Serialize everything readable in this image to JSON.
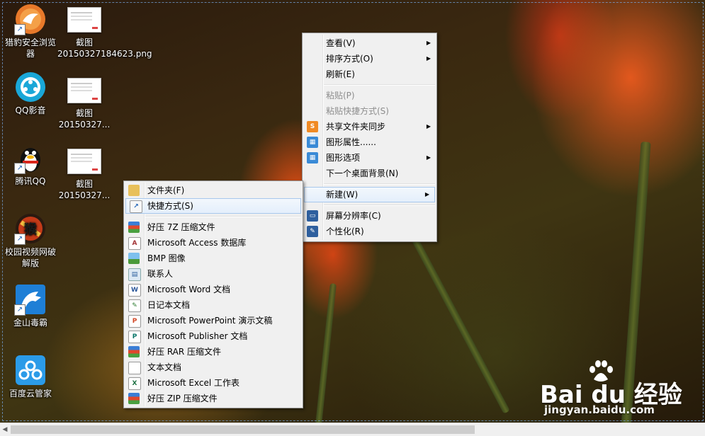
{
  "desktop_icons": [
    {
      "label": "猎豹安全浏览器",
      "icon": "cheetah-browser-icon",
      "shortcut": true
    },
    {
      "label": "QQ影音",
      "icon": "qq-player-icon",
      "shortcut": false
    },
    {
      "label": "腾讯QQ",
      "icon": "qq-penguin-icon",
      "shortcut": true
    },
    {
      "label": "校园视频网破解版",
      "icon": "campus-video-icon",
      "shortcut": true
    },
    {
      "label": "金山毒霸",
      "icon": "kingsoft-antivirus-icon",
      "shortcut": true
    },
    {
      "label": "百度云管家",
      "icon": "baidu-cloud-icon",
      "shortcut": false
    },
    {
      "label": "截图 20150327184623.png",
      "icon": "screenshot-thumbnail",
      "shortcut": false
    },
    {
      "label": "截图 20150327...",
      "icon": "screenshot-thumbnail",
      "shortcut": false
    },
    {
      "label": "截图 20150327...",
      "icon": "screenshot-thumbnail",
      "shortcut": false
    }
  ],
  "context_menu": {
    "items": [
      {
        "label": "查看(V)",
        "submenu": true
      },
      {
        "label": "排序方式(O)",
        "submenu": true
      },
      {
        "label": "刷新(E)"
      },
      {
        "label": "粘贴(P)",
        "disabled": true
      },
      {
        "label": "粘贴快捷方式(S)",
        "disabled": true
      },
      {
        "label": "共享文件夹同步",
        "submenu": true,
        "icon": "share-sync-icon"
      },
      {
        "label": "图形属性......",
        "icon": "graphics-properties-icon"
      },
      {
        "label": "图形选项",
        "submenu": true,
        "icon": "graphics-options-icon"
      },
      {
        "label": "下一个桌面背景(N)"
      },
      {
        "label": "新建(W)",
        "submenu": true,
        "highlighted": true
      },
      {
        "label": "屏幕分辨率(C)",
        "icon": "screen-resolution-icon"
      },
      {
        "label": "个性化(R)",
        "icon": "personalize-icon"
      }
    ]
  },
  "new_submenu": {
    "items": [
      {
        "label": "文件夹(F)",
        "icon": "folder-icon"
      },
      {
        "label": "快捷方式(S)",
        "icon": "shortcut-icon",
        "highlighted": true
      },
      {
        "label": "好压 7Z 压缩文件",
        "icon": "haozip-7z-icon"
      },
      {
        "label": "Microsoft Access 数据库",
        "icon": "access-icon"
      },
      {
        "label": "BMP 图像",
        "icon": "bmp-image-icon"
      },
      {
        "label": "联系人",
        "icon": "contact-icon"
      },
      {
        "label": "Microsoft Word 文档",
        "icon": "word-icon"
      },
      {
        "label": "日记本文档",
        "icon": "journal-icon"
      },
      {
        "label": "Microsoft PowerPoint 演示文稿",
        "icon": "powerpoint-icon"
      },
      {
        "label": "Microsoft Publisher 文档",
        "icon": "publisher-icon"
      },
      {
        "label": "好压 RAR 压缩文件",
        "icon": "haozip-rar-icon"
      },
      {
        "label": "文本文档",
        "icon": "text-document-icon"
      },
      {
        "label": "Microsoft Excel 工作表",
        "icon": "excel-icon"
      },
      {
        "label": "好压 ZIP 压缩文件",
        "icon": "haozip-zip-icon"
      }
    ]
  },
  "watermark": {
    "brand": "Bai du 经验",
    "url": "jingyan.baidu.com"
  },
  "colors": {
    "menu_bg": "#f0f0f0",
    "highlight_border": "#a8c8ec",
    "disabled_text": "#8d8d8d"
  }
}
